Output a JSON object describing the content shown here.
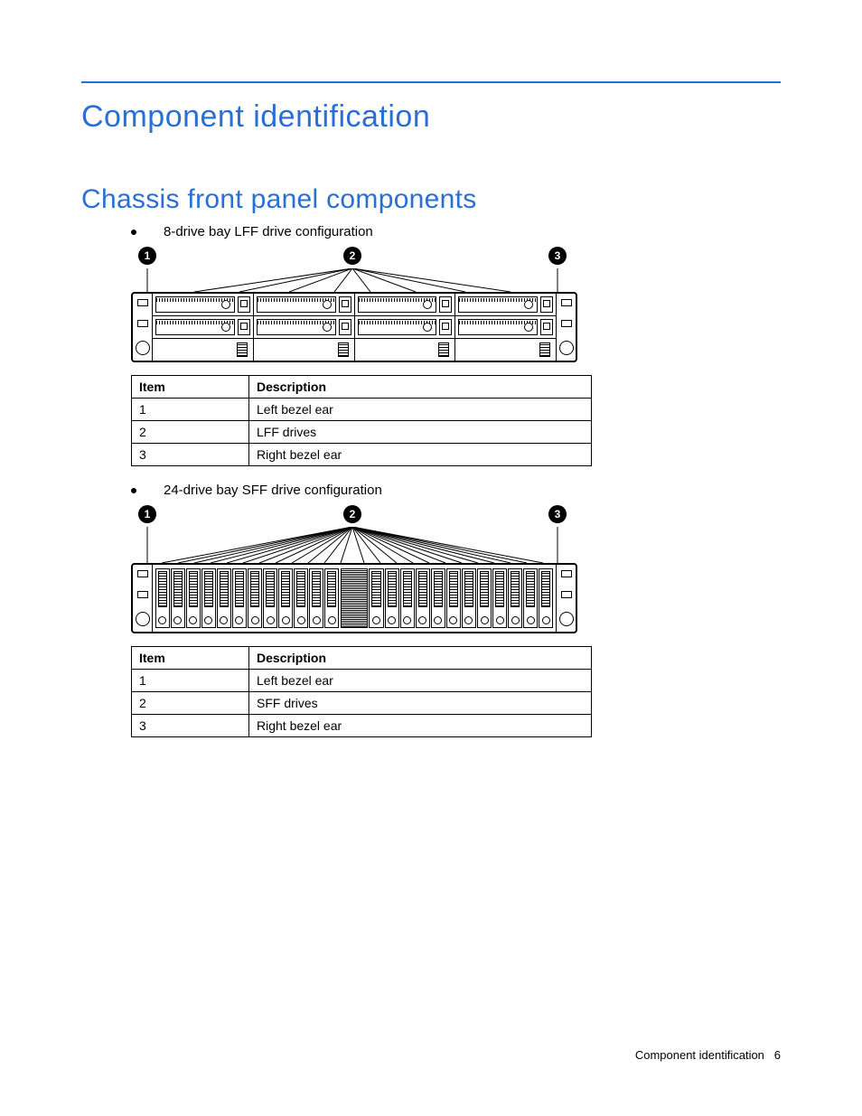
{
  "headings": {
    "h1": "Component identification",
    "h2": "Chassis front panel components"
  },
  "sections": [
    {
      "bullet": "8-drive bay LFF drive configuration",
      "callouts": [
        "1",
        "2",
        "3"
      ],
      "table": {
        "headers": [
          "Item",
          "Description"
        ],
        "rows": [
          [
            "1",
            "Left bezel ear"
          ],
          [
            "2",
            "LFF drives"
          ],
          [
            "3",
            "Right bezel ear"
          ]
        ]
      }
    },
    {
      "bullet": "24-drive bay SFF drive configuration",
      "callouts": [
        "1",
        "2",
        "3"
      ],
      "table": {
        "headers": [
          "Item",
          "Description"
        ],
        "rows": [
          [
            "1",
            "Left bezel ear"
          ],
          [
            "2",
            "SFF drives"
          ],
          [
            "3",
            "Right bezel ear"
          ]
        ]
      }
    }
  ],
  "footer": {
    "label": "Component identification",
    "page": "6"
  }
}
